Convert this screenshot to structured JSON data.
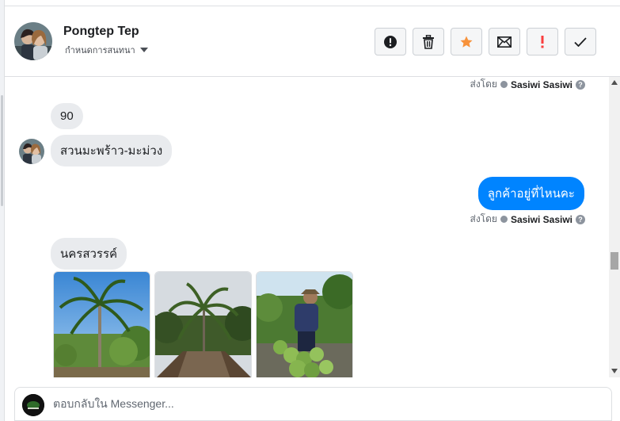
{
  "header": {
    "contact_name": "Pongtep Tep",
    "subtitle": "กำหนดการสนทนา",
    "actions": [
      {
        "name": "report",
        "icon": "exclamation-circle-icon"
      },
      {
        "name": "delete",
        "icon": "trash-icon"
      },
      {
        "name": "star",
        "icon": "star-icon"
      },
      {
        "name": "mark-unread",
        "icon": "envelope-icon"
      },
      {
        "name": "spam",
        "icon": "exclamation-icon"
      },
      {
        "name": "done",
        "icon": "check-icon"
      }
    ]
  },
  "thread": {
    "sent_by_label": "ส่งโดย",
    "sender_name": "Sasiwi Sasiwi",
    "help_glyph": "?",
    "messages": [
      {
        "from": "contact",
        "text": "90"
      },
      {
        "from": "contact",
        "text": "สวนมะพร้าว-มะม่วง"
      },
      {
        "from": "page",
        "text": "ลูกค้าอยู่ที่ไหนคะ"
      },
      {
        "from": "contact",
        "text": "นครสวรรค์"
      }
    ],
    "photos": [
      "coconut-tree-photo",
      "coconut-canal-photo",
      "coconut-harvest-photo"
    ]
  },
  "composer": {
    "placeholder": "ตอบกลับใน Messenger..."
  },
  "colors": {
    "accent": "#0084ff",
    "incoming_bubble": "#e9ebee",
    "star": "#f7923b",
    "spam": "#fa3e3e"
  }
}
